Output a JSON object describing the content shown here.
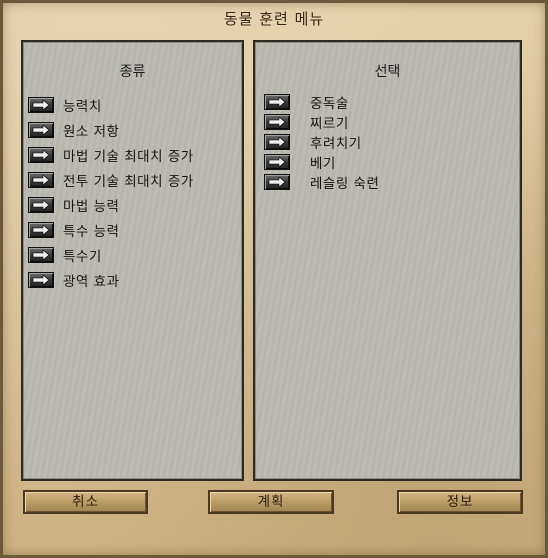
{
  "window": {
    "title": "동물 훈련 메뉴"
  },
  "left_panel": {
    "header": "종류",
    "items": [
      {
        "label": "능력치"
      },
      {
        "label": "원소 저항"
      },
      {
        "label": "마법 기술 최대치 증가"
      },
      {
        "label": "전투 기술 최대치 증가"
      },
      {
        "label": "마법 능력"
      },
      {
        "label": "특수 능력"
      },
      {
        "label": "특수기"
      },
      {
        "label": "광역 효과"
      }
    ]
  },
  "right_panel": {
    "header": "선택",
    "items": [
      {
        "label": "중독술"
      },
      {
        "label": "찌르기"
      },
      {
        "label": "후려치기"
      },
      {
        "label": "베기"
      },
      {
        "label": "레슬링 숙련"
      }
    ]
  },
  "buttons": {
    "cancel_label": "취소",
    "plan_label": "계획",
    "info_label": "정보"
  },
  "icons": {
    "item_button": "arrow-right-icon"
  },
  "colors": {
    "frame": "#d6c39a",
    "panel": "#bcbcb4",
    "button": "#b89a63",
    "text": "#161616"
  }
}
